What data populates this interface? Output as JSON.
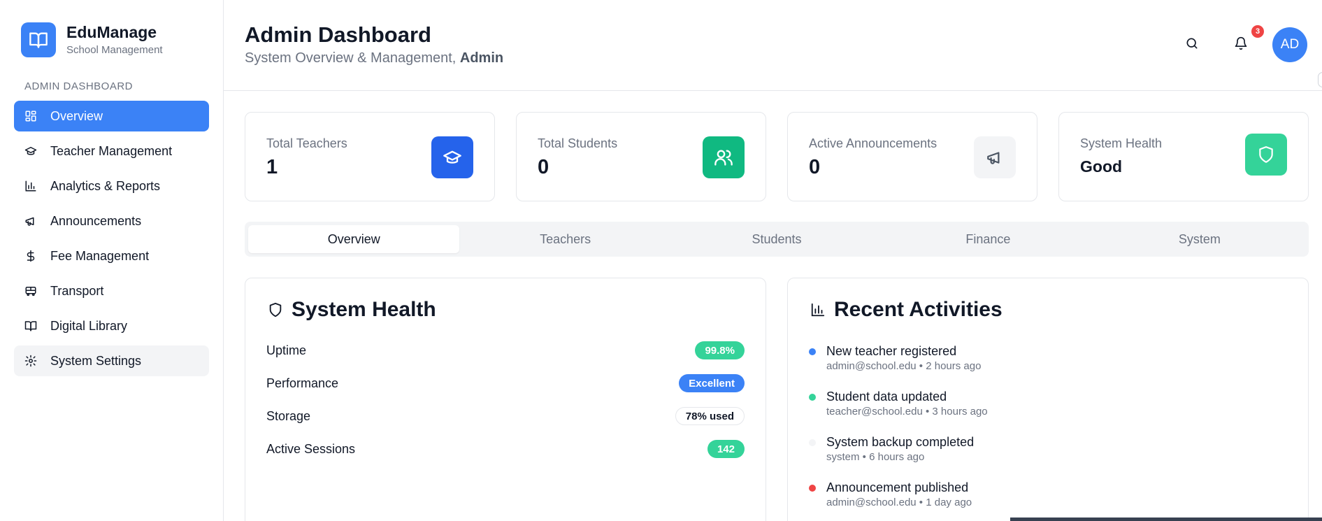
{
  "brand": {
    "name": "EduManage",
    "subtitle": "School Management",
    "icon": "book-open-icon"
  },
  "sidebar": {
    "section_label": "ADMIN DASHBOARD",
    "items": [
      {
        "label": "Overview",
        "icon": "grid-icon",
        "state": "active"
      },
      {
        "label": "Teacher Management",
        "icon": "graduation-cap-icon",
        "state": "normal"
      },
      {
        "label": "Analytics & Reports",
        "icon": "bar-chart-icon",
        "state": "normal"
      },
      {
        "label": "Announcements",
        "icon": "megaphone-icon",
        "state": "normal"
      },
      {
        "label": "Fee Management",
        "icon": "dollar-icon",
        "state": "normal"
      },
      {
        "label": "Transport",
        "icon": "bus-icon",
        "state": "normal"
      },
      {
        "label": "Digital Library",
        "icon": "book-icon",
        "state": "normal"
      },
      {
        "label": "System Settings",
        "icon": "gear-icon",
        "state": "hover"
      }
    ]
  },
  "header": {
    "title": "Admin Dashboard",
    "subtitle_prefix": "System Overview & Management, ",
    "subtitle_user": "Admin",
    "notification_count": "3",
    "avatar_initials": "AD"
  },
  "stats": [
    {
      "label": "Total Teachers",
      "value": "1",
      "icon": "graduation-cap-icon",
      "color": "#2563eb"
    },
    {
      "label": "Total Students",
      "value": "0",
      "icon": "users-icon",
      "color": "#10b981"
    },
    {
      "label": "Active Announcements",
      "value": "0",
      "icon": "megaphone-icon",
      "color": "#f3f4f6"
    },
    {
      "label": "System Health",
      "value": "Good",
      "icon": "shield-icon",
      "color": "#34d399"
    }
  ],
  "tabs": [
    {
      "label": "Overview",
      "active": true
    },
    {
      "label": "Teachers",
      "active": false
    },
    {
      "label": "Students",
      "active": false
    },
    {
      "label": "Finance",
      "active": false
    },
    {
      "label": "System",
      "active": false
    }
  ],
  "system_health": {
    "title": "System Health",
    "rows": [
      {
        "label": "Uptime",
        "value": "99.8%",
        "style": "green"
      },
      {
        "label": "Performance",
        "value": "Excellent",
        "style": "blue"
      },
      {
        "label": "Storage",
        "value": "78% used",
        "style": "outline"
      },
      {
        "label": "Active Sessions",
        "value": "142",
        "style": "green"
      }
    ]
  },
  "recent_activities": {
    "title": "Recent Activities",
    "items": [
      {
        "title": "New teacher registered",
        "user": "admin@school.edu",
        "time": "2 hours ago",
        "dot_color": "#3b82f6"
      },
      {
        "title": "Student data updated",
        "user": "teacher@school.edu",
        "time": "3 hours ago",
        "dot_color": "#34d399"
      },
      {
        "title": "System backup completed",
        "user": "system",
        "time": "6 hours ago",
        "dot_color": "#f3f4f6"
      },
      {
        "title": "Announcement published",
        "user": "admin@school.edu",
        "time": "1 day ago",
        "dot_color": "#ef4444"
      }
    ]
  }
}
